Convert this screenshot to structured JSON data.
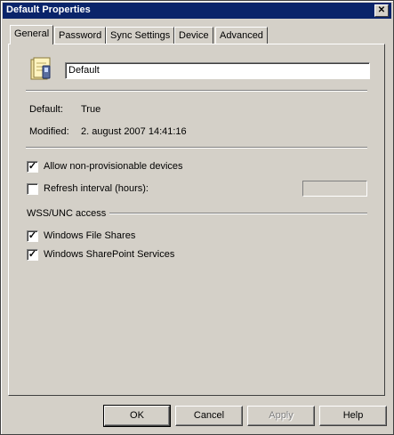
{
  "window": {
    "title": "Default Properties",
    "close_glyph": "✕"
  },
  "tabs": [
    {
      "label": "General",
      "active": true
    },
    {
      "label": "Password",
      "active": false
    },
    {
      "label": "Sync Settings",
      "active": false
    },
    {
      "label": "Device",
      "active": false
    },
    {
      "label": "Advanced",
      "active": false
    }
  ],
  "general": {
    "icon": "profile-document-icon",
    "name_value": "Default",
    "default_label": "Default:",
    "default_value": "True",
    "modified_label": "Modified:",
    "modified_value": "2. august 2007 14:41:16"
  },
  "options": {
    "allow_label": "Allow non-provisionable devices",
    "allow_checked": true,
    "refresh_label": "Refresh interval (hours):",
    "refresh_checked": false,
    "refresh_value": ""
  },
  "wss": {
    "heading": "WSS/UNC access",
    "file_shares_label": "Windows File Shares",
    "file_shares_checked": true,
    "sharepoint_label": "Windows SharePoint Services",
    "sharepoint_checked": true
  },
  "buttons": {
    "ok": "OK",
    "cancel": "Cancel",
    "apply": "Apply",
    "help": "Help"
  },
  "check_glyph": "✓"
}
